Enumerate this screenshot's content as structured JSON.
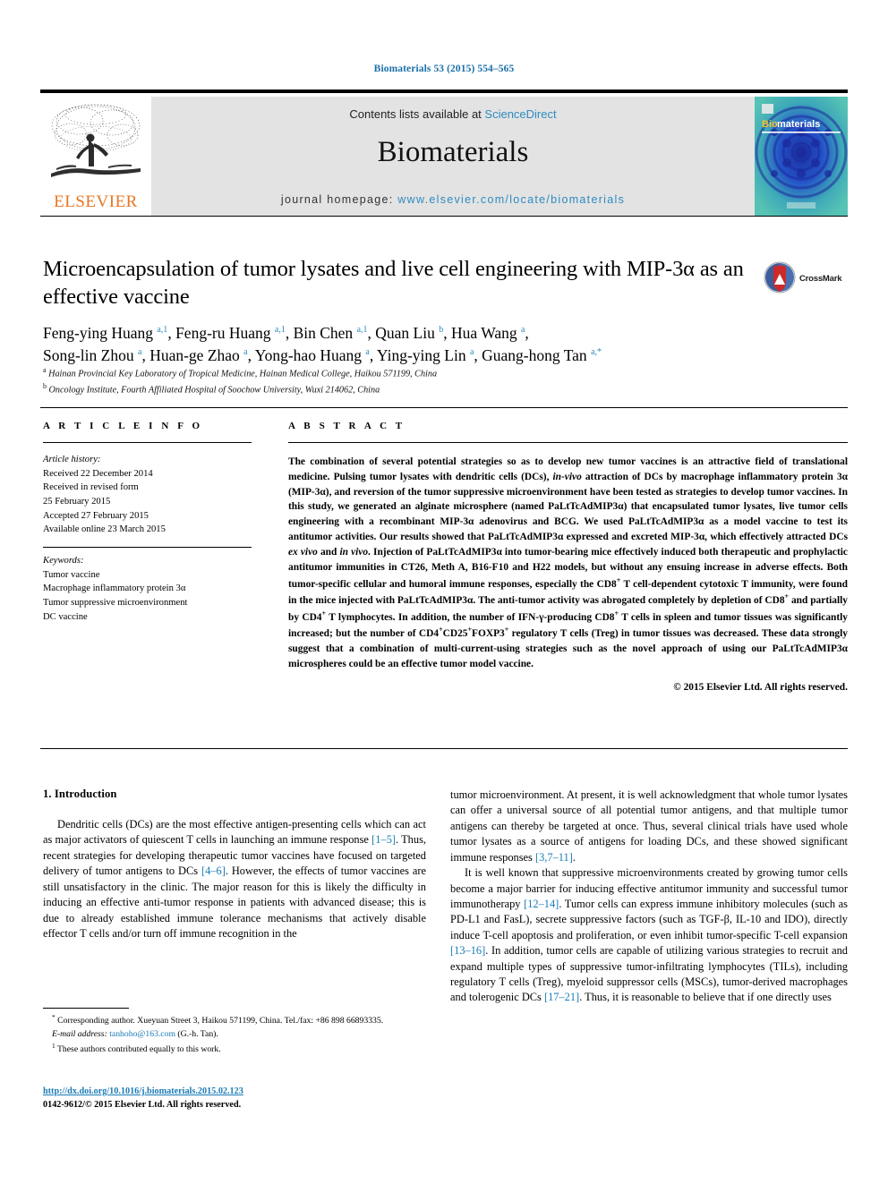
{
  "running_head": "Biomaterials 53 (2015) 554–565",
  "masthead": {
    "contents_prefix": "Contents lists available at ",
    "sciencedirect": "ScienceDirect",
    "journal_name": "Biomaterials",
    "homepage_prefix": "journal homepage: ",
    "homepage_url": "www.elsevier.com/locate/biomaterials",
    "publisher_wordmark": "ELSEVIER",
    "cover_wordmark_a": "Bio",
    "cover_wordmark_b": "materials"
  },
  "crossmark": {
    "label": "CrossMark"
  },
  "title": "Microencapsulation of tumor lysates and live cell engineering with MIP-3α as an effective vaccine",
  "authors_line1": "Feng-ying Huang ^a,1^, Feng-ru Huang ^a,1^, Bin Chen ^a,1^, Quan Liu ^b^, Hua Wang ^a^,",
  "authors_line2": "Song-lin Zhou ^a^, Huan-ge Zhao ^a^, Yong-hao Huang ^a^, Ying-ying Lin ^a^, Guang-hong Tan ^a,*^",
  "affiliations": [
    {
      "marker": "a",
      "text": "Hainan Provincial Key Laboratory of Tropical Medicine, Hainan Medical College, Haikou 571199, China"
    },
    {
      "marker": "b",
      "text": "Oncology Institute, Fourth Affiliated Hospital of Soochow University, Wuxi 214062, China"
    }
  ],
  "headers": {
    "article_info": "A R T I C L E   I N F O",
    "abstract": "A B S T R A C T"
  },
  "article_history": {
    "label": "Article history:",
    "lines": [
      "Received 22 December 2014",
      "Received in revised form",
      "25 February 2015",
      "Accepted 27 February 2015",
      "Available online 23 March 2015"
    ]
  },
  "keywords": {
    "label": "Keywords:",
    "items": [
      "Tumor vaccine",
      "Macrophage inflammatory protein 3α",
      "Tumor suppressive microenvironment",
      "DC vaccine"
    ]
  },
  "abstract_text": "The combination of several potential strategies so as to develop new tumor vaccines is an attractive field of translational medicine. Pulsing tumor lysates with dendritic cells (DCs), in-vivo attraction of DCs by macrophage inflammatory protein 3α (MIP-3α), and reversion of the tumor suppressive microenvironment have been tested as strategies to develop tumor vaccines. In this study, we generated an alginate microsphere (named PaLtTcAdMIP3α) that encapsulated tumor lysates, live tumor cells engineering with a recombinant MIP-3α adenovirus and BCG. We used PaLtTcAdMIP3α as a model vaccine to test its antitumor activities. Our results showed that PaLtTcAdMIP3α expressed and excreted MIP-3α, which effectively attracted DCs ex vivo and in vivo. Injection of PaLtTcAdMIP3α into tumor-bearing mice effectively induced both therapeutic and prophylactic antitumor immunities in CT26, Meth A, B16-F10 and H22 models, but without any ensuing increase in adverse effects. Both tumor-specific cellular and humoral immune responses, especially the CD8+ T cell-dependent cytotoxic T immunity, were found in the mice injected with PaLtTcAdMIP3α. The anti-tumor activity was abrogated completely by depletion of CD8+ and partially by CD4+ T lymphocytes. In addition, the number of IFN-γ-producing CD8+ T cells in spleen and tumor tissues was significantly increased; but the number of CD4+CD25+FOXP3+ regulatory T cells (Treg) in tumor tissues was decreased. These data strongly suggest that a combination of multi-current-using strategies such as the novel approach of using our PaLtTcAdMIP3α microspheres could be an effective tumor model vaccine.",
  "abstract_copyright": "© 2015 Elsevier Ltd. All rights reserved.",
  "intro_heading": "1. Introduction",
  "intro_left_p1": "Dendritic cells (DCs) are the most effective antigen-presenting cells which can act as major activators of quiescent T cells in launching an immune response [1–5]. Thus, recent strategies for developing therapeutic tumor vaccines have focused on targeted delivery of tumor antigens to DCs [4–6]. However, the effects of tumor vaccines are still unsatisfactory in the clinic. The major reason for this is likely the difficulty in inducing an effective anti-tumor response in patients with advanced disease; this is due to already established immune tolerance mechanisms that actively disable effector T cells and/or turn off immune recognition in the",
  "intro_right_p1": "tumor microenvironment. At present, it is well acknowledgment that whole tumor lysates can offer a universal source of all potential tumor antigens, and that multiple tumor antigens can thereby be targeted at once. Thus, several clinical trials have used whole tumor lysates as a source of antigens for loading DCs, and these showed significant immune responses [3,7–11].",
  "intro_right_p2": "It is well known that suppressive microenvironments created by growing tumor cells become a major barrier for inducing effective antitumor immunity and successful tumor immunotherapy [12–14]. Tumor cells can express immune inhibitory molecules (such as PD-L1 and FasL), secrete suppressive factors (such as TGF-β, IL-10 and IDO), directly induce T-cell apoptosis and proliferation, or even inhibit tumor-specific T-cell expansion [13–16]. In addition, tumor cells are capable of utilizing various strategies to recruit and expand multiple types of suppressive tumor-infiltrating lymphocytes (TILs), including regulatory T cells (Treg), myeloid suppressor cells (MSCs), tumor-derived macrophages and tolerogenic DCs [17–21]. Thus, it is reasonable to believe that if one directly uses",
  "footnotes": {
    "corresponding": "Corresponding author. Xueyuan Street 3, Haikou 571199, China. Tel./fax: +86 898 66893335.",
    "email_label": "E-mail address:",
    "email": "tanhoho@163.com",
    "email_suffix": "(G.-h. Tan).",
    "equal_contribution": "These authors contributed equally to this work."
  },
  "doi": "http://dx.doi.org/10.1016/j.biomaterials.2015.02.123",
  "issn_line": "0142-9612/© 2015 Elsevier Ltd. All rights reserved.",
  "colors": {
    "link_blue": "#1a7bb5",
    "sciencedirect_blue": "#2e8bc0",
    "elsevier_orange": "#E87722",
    "masthead_gray": "#e3e3e3"
  }
}
